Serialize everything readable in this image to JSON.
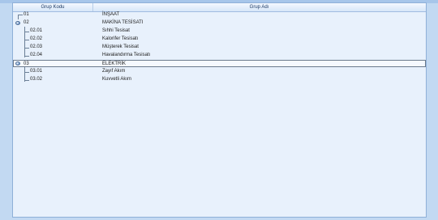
{
  "columns": {
    "code": "Grup Kodu",
    "name": "Grup Adı"
  },
  "rows": [
    {
      "code": "01",
      "name": "İNŞAAT",
      "level": 0,
      "selected": false
    },
    {
      "code": "02",
      "name": "MAKİNA TESİSATI",
      "level": 0,
      "selected": false
    },
    {
      "code": "02.01",
      "name": "Sıhhi Tesisat",
      "level": 1,
      "selected": false
    },
    {
      "code": "02.02",
      "name": "Kalorifer Tesisatı",
      "level": 1,
      "selected": false
    },
    {
      "code": "02.03",
      "name": "Müşterek Tesisat",
      "level": 1,
      "selected": false
    },
    {
      "code": "02.04",
      "name": "Havalandırma Tesisatı",
      "level": 1,
      "selected": false
    },
    {
      "code": "03",
      "name": "ELEKTRİK",
      "level": 0,
      "selected": true
    },
    {
      "code": "03.01",
      "name": "Zayıf Akım",
      "level": 1,
      "selected": false
    },
    {
      "code": "03.02",
      "name": "Kuvvetli Akım",
      "level": 1,
      "selected": false
    }
  ],
  "colors": {
    "background": "#c2d9f2",
    "grid": "#e8f1fc",
    "selection_border": "#6b7a8c",
    "header_text": "#1d3a64"
  },
  "icons": {
    "expand_node": "expanded-node-icon"
  }
}
